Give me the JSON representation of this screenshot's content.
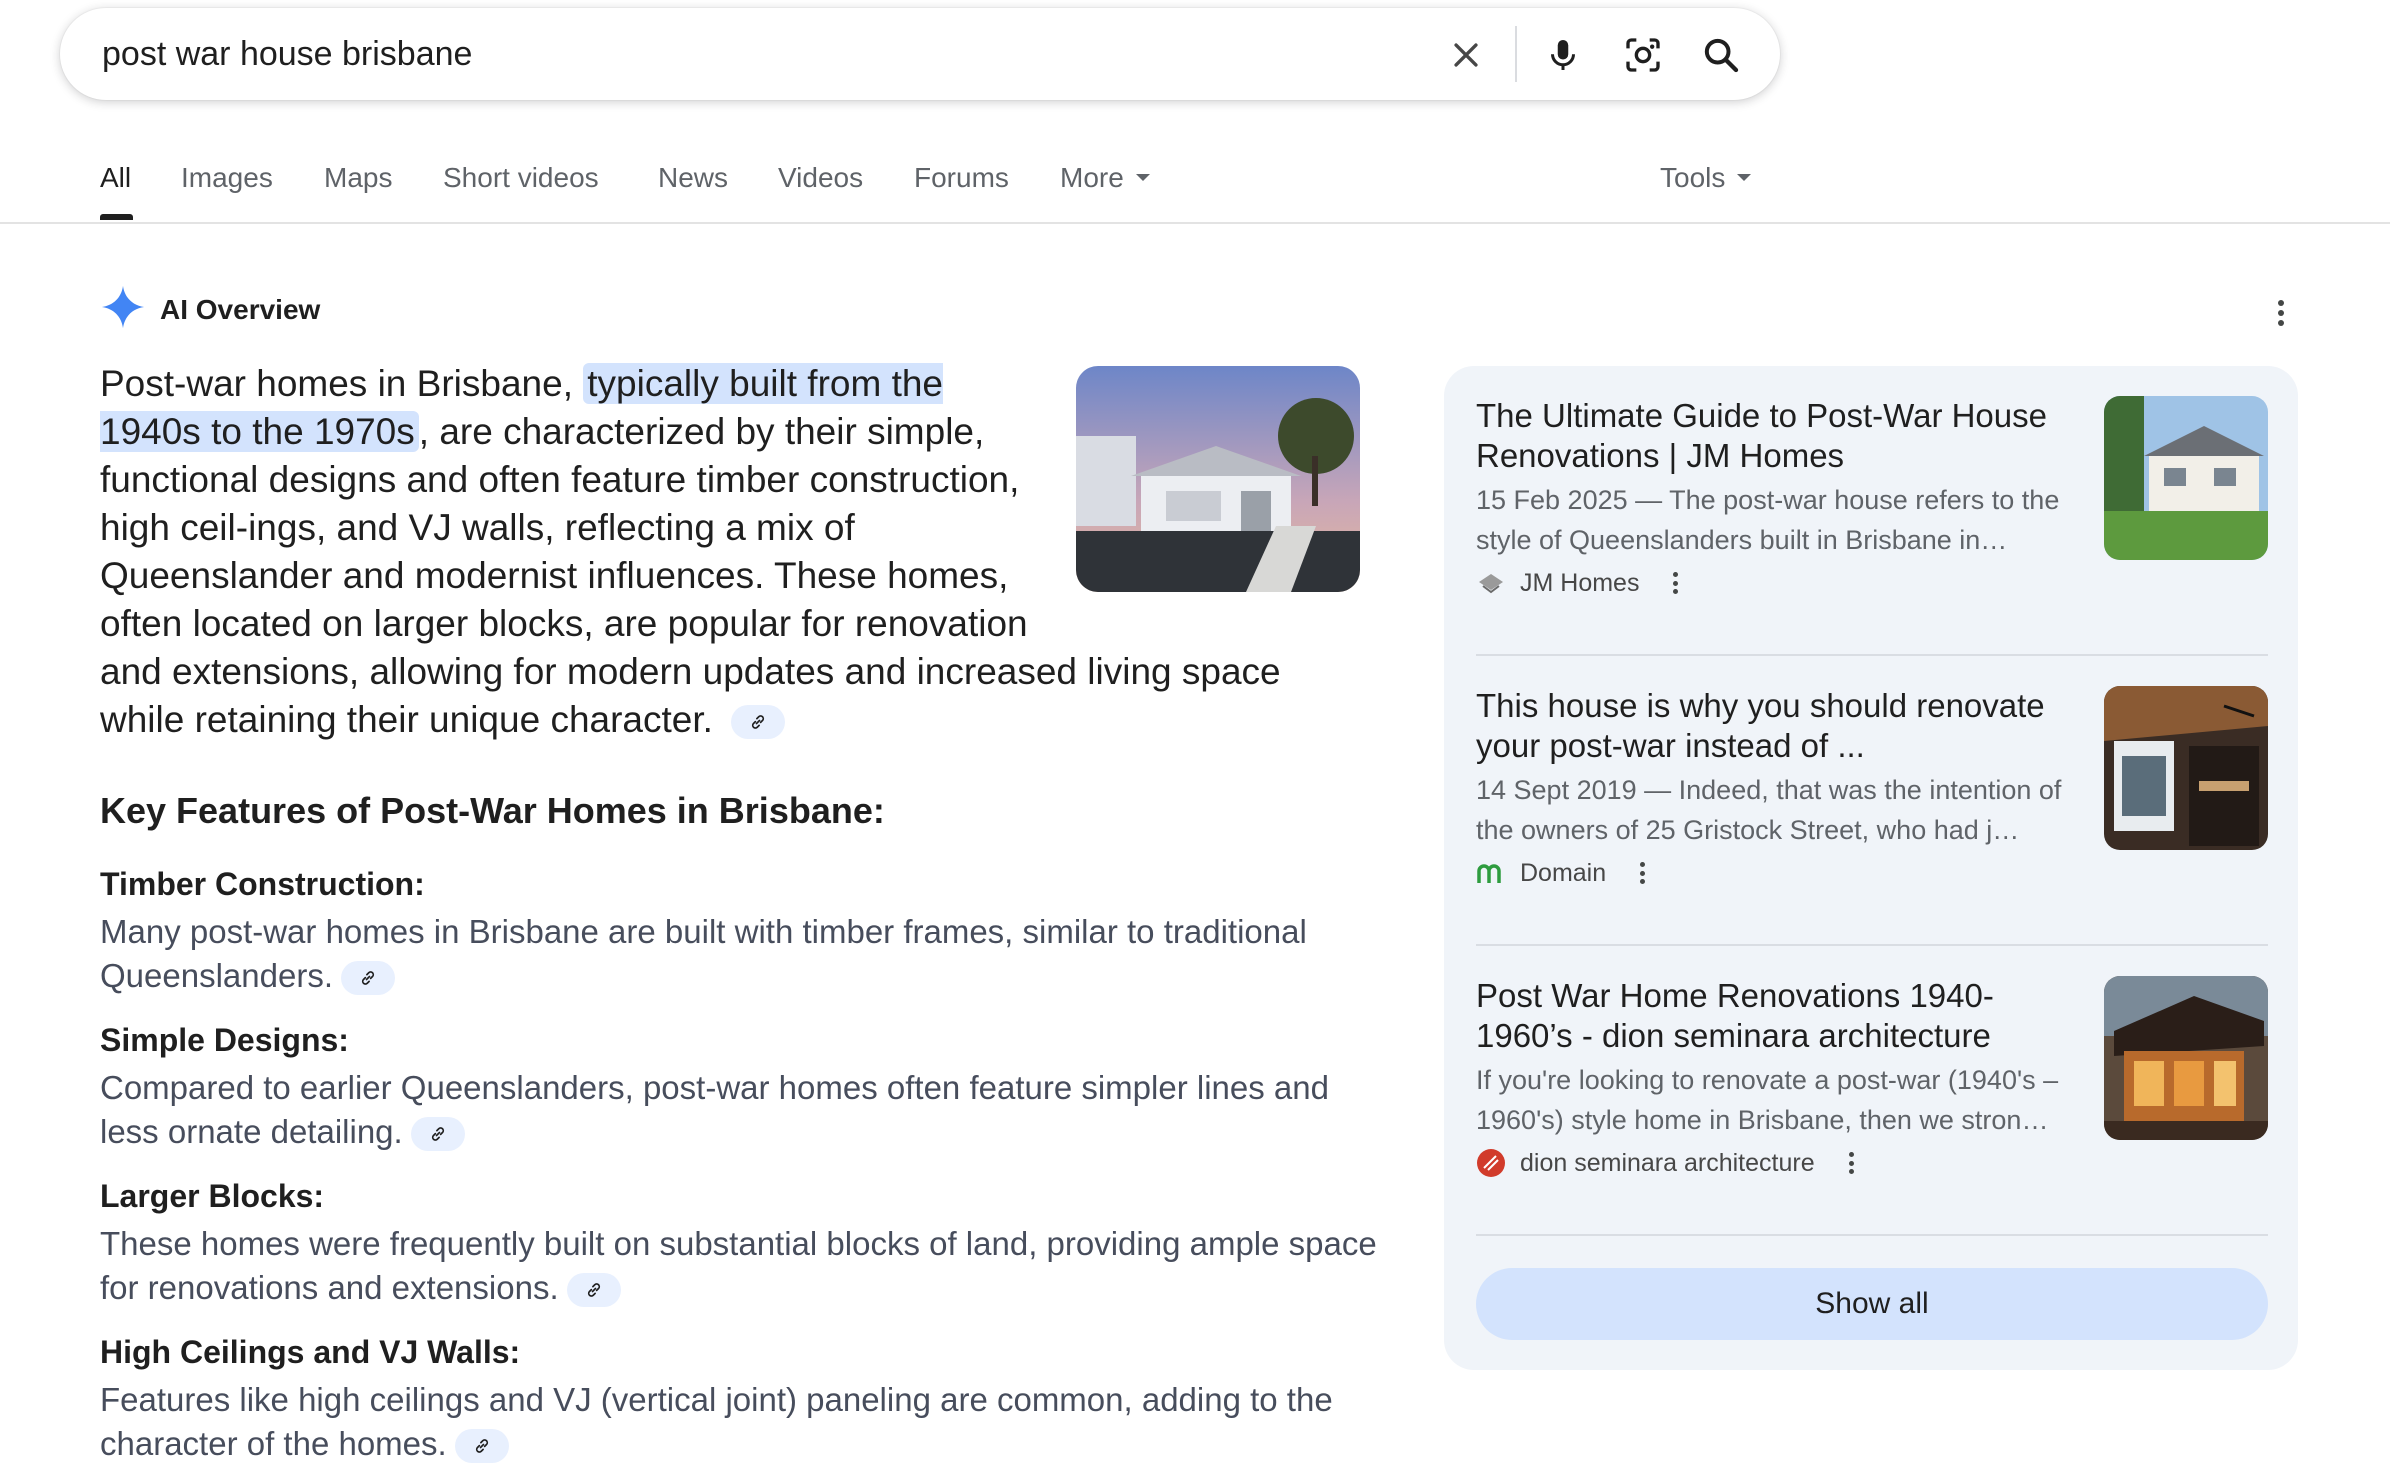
{
  "search": {
    "query": "post war house brisbane"
  },
  "tabs": [
    {
      "label": "All",
      "active": true
    },
    {
      "label": "Images"
    },
    {
      "label": "Maps"
    },
    {
      "label": "Short videos"
    },
    {
      "label": "News"
    },
    {
      "label": "Videos"
    },
    {
      "label": "Forums"
    },
    {
      "label": "More"
    }
  ],
  "tools_label": "Tools",
  "ai_overview": {
    "label": "AI Overview",
    "intro_pre": "Post-war homes in Brisbane, ",
    "intro_highlight": "typically built from the 1940s to the 1970s",
    "intro_post": ", are characterized by their simple, functional designs and often feature timber construction, high ceil-ings, and VJ walls, reflecting a mix of Queenslander and modernist influences. These homes, often located on larger blocks, are popular for renovation and extensions, allowing for modern updates and increased living space while retaining their unique character.",
    "features_title": "Key Features of Post-War Homes in Brisbane:",
    "features": [
      {
        "heading": "Timber Construction:",
        "text": "Many post-war homes in Brisbane are built with timber frames, similar to traditional Queenslanders."
      },
      {
        "heading": "Simple Designs:",
        "text": "Compared to earlier Queenslanders, post-war homes often feature simpler lines and less ornate detailing."
      },
      {
        "heading": "Larger Blocks:",
        "text": "These homes were frequently built on substantial blocks of land, providing ample space for renovations and extensions."
      },
      {
        "heading": "High Ceilings and VJ Walls:",
        "text": "Features like high ceilings and VJ (vertical joint) paneling are common, adding to the character of the homes."
      }
    ]
  },
  "sources": [
    {
      "title": "The Ultimate Guide to Post-War House Renovations | JM Homes",
      "snippet": "15 Feb 2025 — The post-war house refers to the style of Queenslanders built in Brisbane in…",
      "site": "JM Homes"
    },
    {
      "title": "This house is why you should renovate your post-war instead of ...",
      "snippet": "14 Sept 2019 — Indeed, that was the intention of the owners of 25 Gristock Street, who had j…",
      "site": "Domain"
    },
    {
      "title": "Post War Home Renovations 1940-1960’s - dion seminara architecture",
      "snippet": "If you're looking to renovate a post-war (1940's – 1960's) style home in Brisbane, then we stron…",
      "site": "dion seminara architecture"
    }
  ],
  "show_all_label": "Show all",
  "colors": {
    "highlight": "#d3e3fd",
    "panel_bg": "#f0f4f9",
    "ai_star": "#4285f4"
  }
}
